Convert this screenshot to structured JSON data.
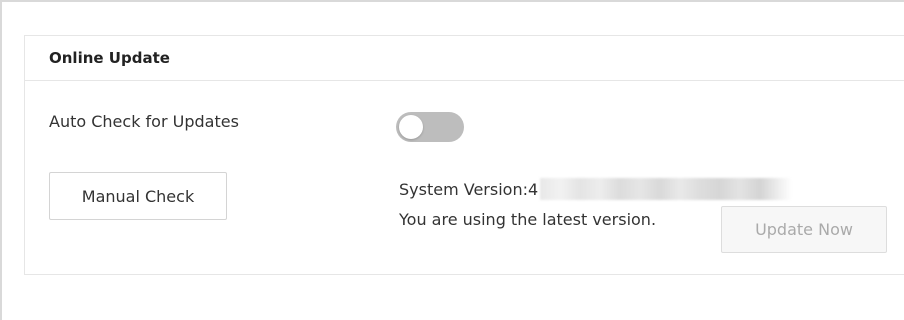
{
  "panel": {
    "title": "Online Update"
  },
  "auto_check": {
    "label": "Auto Check for Updates",
    "enabled": false
  },
  "manual_check": {
    "button_label": "Manual Check"
  },
  "version": {
    "label": "System Version:",
    "value_visible_prefix": "4",
    "status": "You are using the latest version."
  },
  "update_now": {
    "button_label": "Update Now",
    "disabled": true
  },
  "colors": {
    "toggle_off": "#bdbdbd",
    "border": "#e6e6e6",
    "disabled_text": "#aaaaaa"
  }
}
